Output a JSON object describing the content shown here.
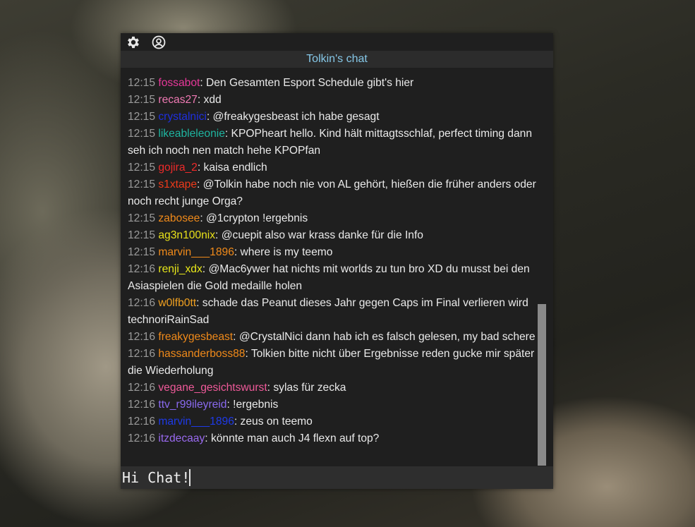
{
  "window": {
    "title": "Tolkin's chat"
  },
  "toolbar": {
    "icons": [
      "gear-icon",
      "user-circle-icon"
    ]
  },
  "colors": {
    "background": "#1f1f1f",
    "title_bar": "#2c2c2c",
    "title_text": "#86c8e8",
    "timestamp": "#9a9a9a",
    "message_text": "#eaeaea"
  },
  "messages": [
    {
      "time": "12:15",
      "user": "fossabot",
      "color": "#e8379a",
      "text": "Den Gesamten Esport Schedule gibt's hier"
    },
    {
      "time": "12:15",
      "user": "recas27",
      "color": "#f07ab4",
      "text": "xdd"
    },
    {
      "time": "12:15",
      "user": "crystalnici",
      "color": "#1e2fe0",
      "text": "@freakygesbeast ich habe gesagt"
    },
    {
      "time": "12:15",
      "user": "likeableleonie",
      "color": "#1fb5a0",
      "text": "KPOPheart hello. Kind hält mittagtsschlaf, perfect timing dann seh ich noch nen match hehe KPOPfan"
    },
    {
      "time": "12:15",
      "user": "gojira_2",
      "color": "#ef2a2a",
      "text": "kaisa endlich"
    },
    {
      "time": "12:15",
      "user": "s1xtape",
      "color": "#ef3a1a",
      "text": "@Tolkin habe noch nie von AL gehört, hießen die früher anders oder noch recht junge Orga?"
    },
    {
      "time": "12:15",
      "user": "zabosee",
      "color": "#f08a1a",
      "text": "@1crypton !ergebnis"
    },
    {
      "time": "12:15",
      "user": "ag3n100nix",
      "color": "#e8e01a",
      "text": "@cuepit also war krass danke für die Info"
    },
    {
      "time": "12:15",
      "user": "marvin___1896",
      "color": "#f08a1a",
      "text": "where is my teemo"
    },
    {
      "time": "12:16",
      "user": "renji_xdx",
      "color": "#e8e81a",
      "text": "@Mac6ywer hat nichts mit worlds zu tun bro XD du musst bei den Asiaspielen die Gold medaille holen"
    },
    {
      "time": "12:16",
      "user": "w0lfb0tt",
      "color": "#f0a020",
      "text": "schade das Peanut dieses Jahr gegen Caps im Final verlieren wird technoriRainSad"
    },
    {
      "time": "12:16",
      "user": "freakygesbeast",
      "color": "#f08a1a",
      "text": "@CrystalNici dann hab ich es falsch gelesen, my bad schere"
    },
    {
      "time": "12:16",
      "user": "hassanderboss88",
      "color": "#f08a1a",
      "text": "Tolkien bitte nicht über Ergebnisse reden gucke mir später die Wiederholung"
    },
    {
      "time": "12:16",
      "user": "vegane_gesichtswurst",
      "color": "#f05a9a",
      "text": "sylas für zecka"
    },
    {
      "time": "12:16",
      "user": "ttv_r99ileyreid",
      "color": "#8a6af0",
      "text": "!ergebnis"
    },
    {
      "time": "12:16",
      "user": "marvin___1896",
      "color": "#1e3ae8",
      "text": "zeus on teemo"
    },
    {
      "time": "12:16",
      "user": "itzdecaay",
      "color": "#9a6af0",
      "text": "könnte man auch J4 flexn auf top?"
    }
  ],
  "input": {
    "value": "Hi Chat!",
    "placeholder": ""
  }
}
